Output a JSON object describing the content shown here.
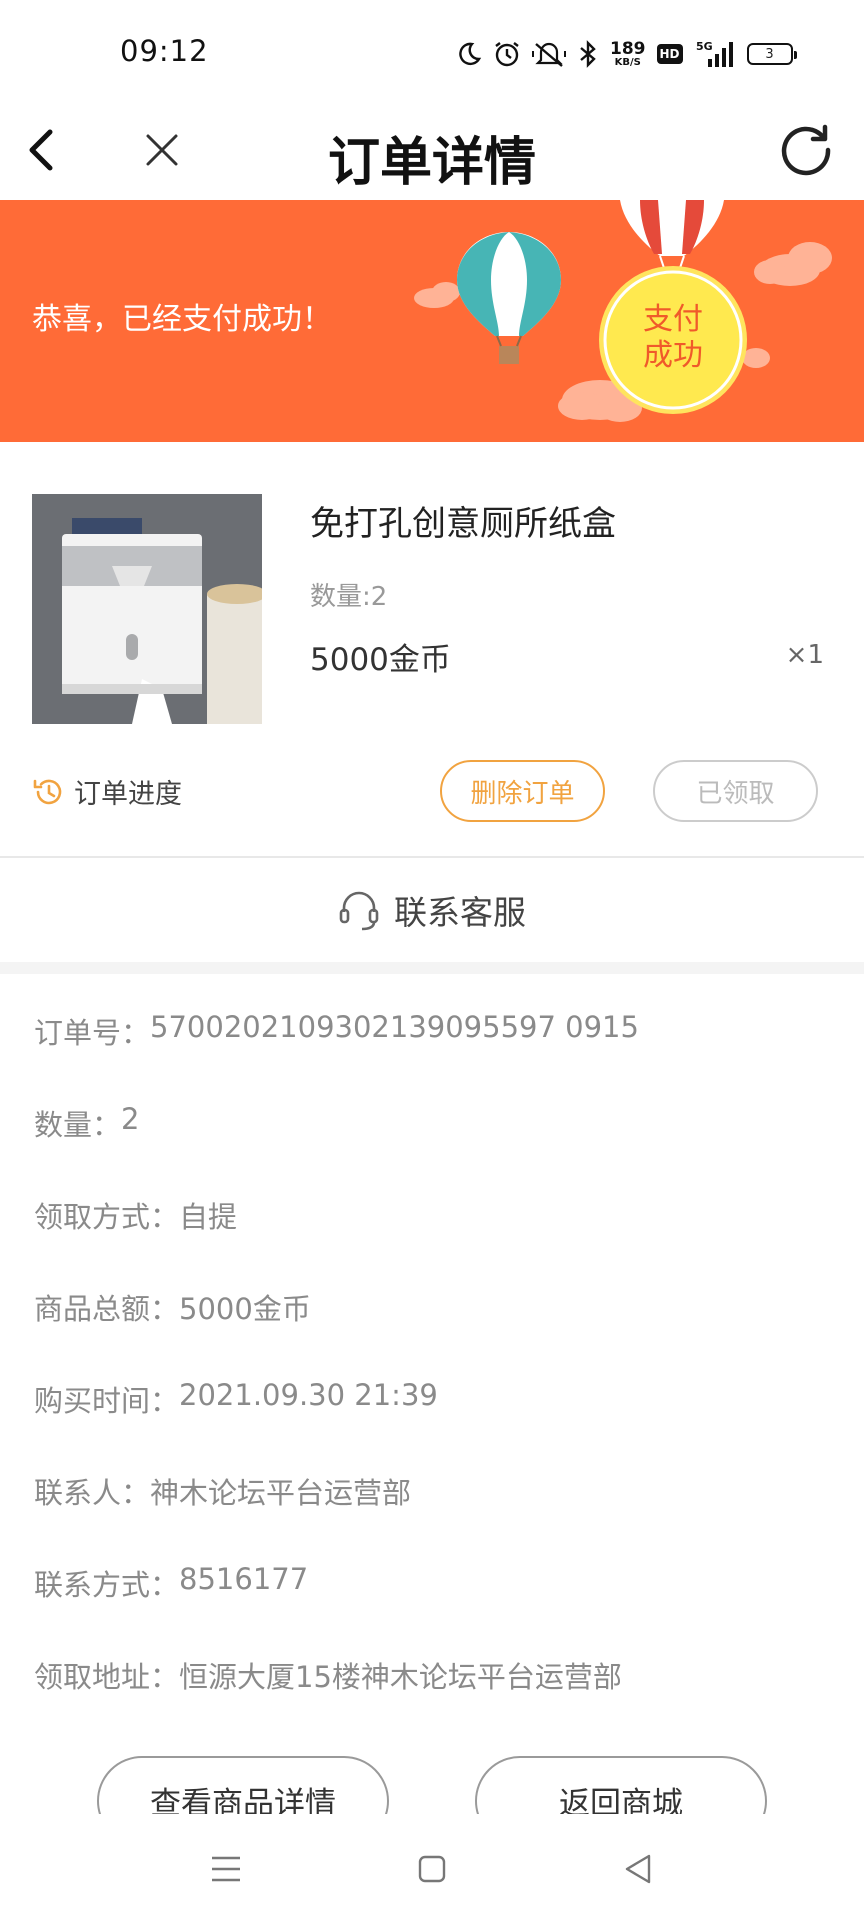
{
  "status_bar": {
    "time": "09:12",
    "net_speed_value": "189",
    "net_speed_unit": "KB/S",
    "hd_label": "HD",
    "signal_label": "5G",
    "battery_level": "3",
    "icons": [
      "moon-icon",
      "alarm-icon",
      "mute-icon",
      "bluetooth-icon",
      "signal-icon",
      "battery-icon"
    ]
  },
  "navbar": {
    "title": "订单详情",
    "icons": [
      "back-arrow-icon",
      "close-icon",
      "refresh-icon"
    ]
  },
  "banner": {
    "message": "恭喜，已经支付成功！",
    "badge_line1": "支付",
    "badge_line2": "成功",
    "background_color": "#ff6b37"
  },
  "product": {
    "name": "免打孔创意厕所纸盒",
    "quantity_label": "数量:2",
    "price": "5000金币",
    "multiplier": "×1"
  },
  "order_actions": {
    "progress_label": "订单进度",
    "delete_label": "删除订单",
    "received_label": "已领取",
    "accent_color": "#f1a340"
  },
  "service": {
    "label": "联系客服"
  },
  "details": [
    {
      "key": "订单号：",
      "value": "5700202109302139095597 0915"
    },
    {
      "key": "数量：",
      "value": "2"
    },
    {
      "key": "领取方式：",
      "value": "自提"
    },
    {
      "key": "商品总额：",
      "value": "5000金币"
    },
    {
      "key": "购买时间：",
      "value": "2021.09.30 21:39"
    },
    {
      "key": "联系人：",
      "value": "神木论坛平台运营部"
    },
    {
      "key": "联系方式：",
      "value": "8516177"
    },
    {
      "key": "领取地址：",
      "value": "恒源大厦15楼神木论坛平台运营部"
    }
  ],
  "bottom_actions": {
    "view_details_label": "查看商品详情",
    "back_to_mall_label": "返回商城"
  },
  "system_nav": {
    "icons": [
      "menu-icon",
      "home-icon",
      "back-triangle-icon"
    ]
  }
}
